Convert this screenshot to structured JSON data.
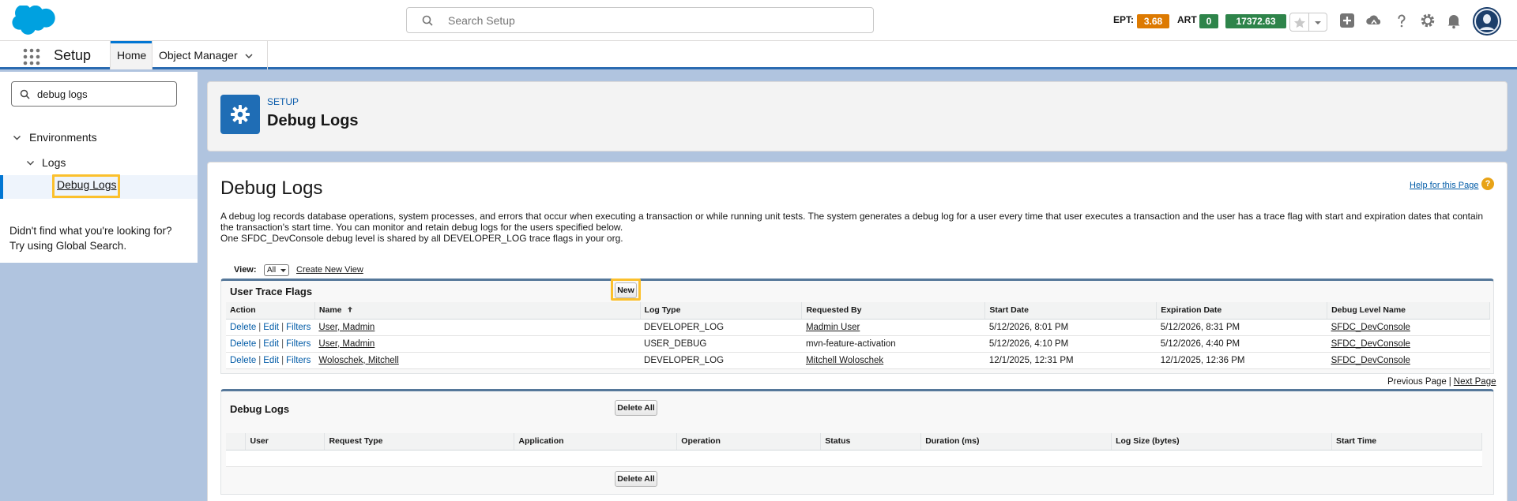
{
  "header": {
    "search_placeholder": "Search Setup",
    "perf": {
      "ept_label": "EPT:",
      "ept_value": "3.68 s",
      "ept_color": "#dd7a01",
      "art_label": "ART",
      "art_value": "0 s",
      "art_color": "#2e844a",
      "kb_value": "17372.63 KB",
      "kb_color": "#2e844a"
    },
    "icons": [
      "add-icon",
      "trailhead-icon",
      "help-icon",
      "gear-icon",
      "bell-icon"
    ]
  },
  "context_bar": {
    "app_name": "Setup",
    "tabs": [
      {
        "label": "Home",
        "active": true
      },
      {
        "label": "Object Manager",
        "active": false
      }
    ]
  },
  "sidebar": {
    "quick_find_value": "debug logs",
    "tree": [
      {
        "label": "Environments",
        "level": 0
      },
      {
        "label": "Logs",
        "level": 1
      },
      {
        "label": "Debug Logs",
        "level": 2,
        "selected": true
      }
    ],
    "not_found_line1": "Didn't find what you're looking for?",
    "not_found_line2": "Try using Global Search."
  },
  "page_header": {
    "eyebrow": "SETUP",
    "title": "Debug Logs"
  },
  "main": {
    "title": "Debug Logs",
    "help_link": "Help for this Page",
    "description_line1": "A debug log records database operations, system processes, and errors that occur when executing a transaction or while running unit tests. The system generates a debug log for a user every time that user executes a transaction and the user has a trace flag with start and expiration dates that contain the transaction's start time. You can monitor and retain debug logs for the users specified below.",
    "description_line2": "One SFDC_DevConsole debug level is shared by all DEVELOPER_LOG trace flags in your org.",
    "view_label": "View:",
    "view_selected": "All",
    "create_new_view": "Create New View",
    "trace_flags": {
      "title": "User Trace Flags",
      "new_button": "New",
      "columns": [
        "Action",
        "Name",
        "Log Type",
        "Requested By",
        "Start Date",
        "Expiration Date",
        "Debug Level Name"
      ],
      "action_links": [
        "Delete",
        "Edit",
        "Filters"
      ],
      "rows": [
        {
          "name": "User, Madmin",
          "log_type": "DEVELOPER_LOG",
          "requested_by": "Madmin User",
          "requested_by_link": true,
          "start": "5/12/2026, 8:01 PM",
          "expiration": "5/12/2026, 8:31 PM",
          "debug_level": "SFDC_DevConsole"
        },
        {
          "name": "User, Madmin",
          "log_type": "USER_DEBUG",
          "requested_by": "mvn-feature-activation",
          "requested_by_link": false,
          "start": "5/12/2026, 4:10 PM",
          "expiration": "5/12/2026, 4:40 PM",
          "debug_level": "SFDC_DevConsole"
        },
        {
          "name": "Woloschek, Mitchell",
          "log_type": "DEVELOPER_LOG",
          "requested_by": "Mitchell Woloschek",
          "requested_by_link": true,
          "start": "12/1/2025, 12:31 PM",
          "expiration": "12/1/2025, 12:36 PM",
          "debug_level": "SFDC_DevConsole"
        }
      ],
      "prev_page": "Previous Page",
      "next_page": "Next Page"
    },
    "debug_logs": {
      "title": "Debug Logs",
      "delete_all": "Delete All",
      "columns": [
        "User",
        "Request Type",
        "Application",
        "Operation",
        "Status",
        "Duration (ms)",
        "Log Size (bytes)",
        "Start Time"
      ]
    }
  }
}
